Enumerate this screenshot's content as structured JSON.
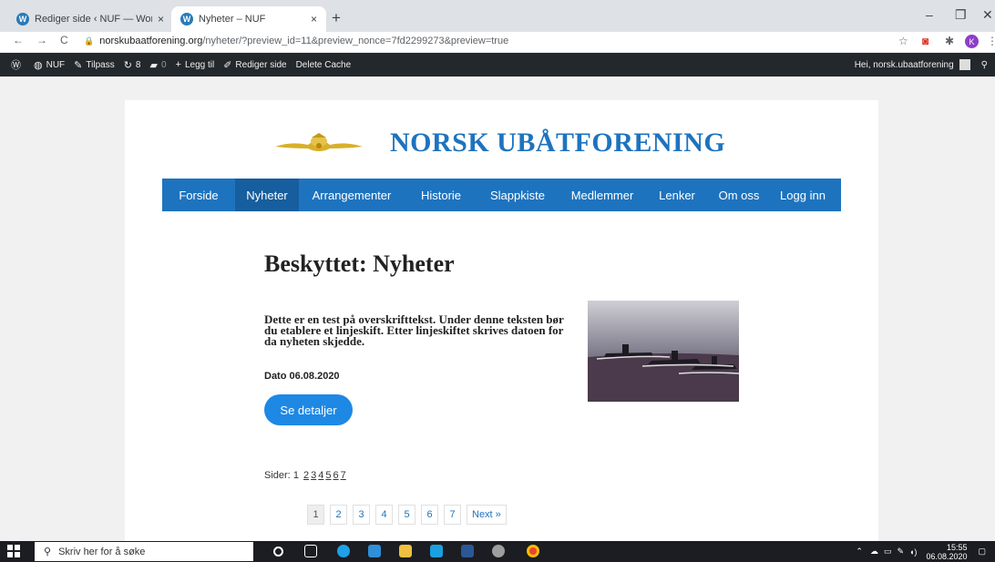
{
  "browser": {
    "tabs": [
      {
        "title": "Rediger side ‹ NUF — WordPress",
        "close": "×"
      },
      {
        "title": "Nyheter – NUF",
        "close": "×"
      }
    ],
    "new_tab": "+",
    "window_controls": {
      "minimize": "–",
      "restore": "❐",
      "close": "✕"
    },
    "nav": {
      "back": "←",
      "forward": "→",
      "reload": "C"
    },
    "url_host": "norskubaatforening.org",
    "url_path": "/nyheter/?preview_id=11&preview_nonce=7fd2299273&preview=true",
    "profile_initial": "K"
  },
  "adminbar": {
    "items": [
      "NUF",
      "Tilpass",
      "8",
      "0",
      "Legg til",
      "Rediger side",
      "Delete Cache"
    ],
    "greeting": "Hei, norsk.ubaatforening"
  },
  "site": {
    "title": "NORSK UBÅTFORENING",
    "nav": [
      "Forside",
      "Nyheter",
      "Arrangementer",
      "Historie",
      "Slappkiste",
      "Medlemmer",
      "Lenker",
      "Om oss",
      "Logg inn"
    ],
    "active_nav": "Nyheter"
  },
  "content": {
    "heading": "Beskyttet: Nyheter",
    "lead": "Dette er en test på overskrifttekst. Under denne teksten bør du etablere et linjeskift. Etter linjeskiftet skrives datoen for da nyheten skjedde.",
    "date": "Dato 06.08.2020",
    "button": "Se detaljer",
    "pages_label": "Sider:",
    "pages_current": "1",
    "pages_links": [
      "2",
      "3",
      "4",
      "5",
      "6",
      "7"
    ],
    "pagination": [
      "1",
      "2",
      "3",
      "4",
      "5",
      "6",
      "7",
      "Next »"
    ]
  },
  "taskbar": {
    "search_placeholder": "Skriv her for å søke",
    "time": "15:55",
    "date": "06.08.2020"
  },
  "colors": {
    "brand_blue": "#1e73be",
    "button_blue": "#1e88e5",
    "adminbar": "#23282d"
  }
}
